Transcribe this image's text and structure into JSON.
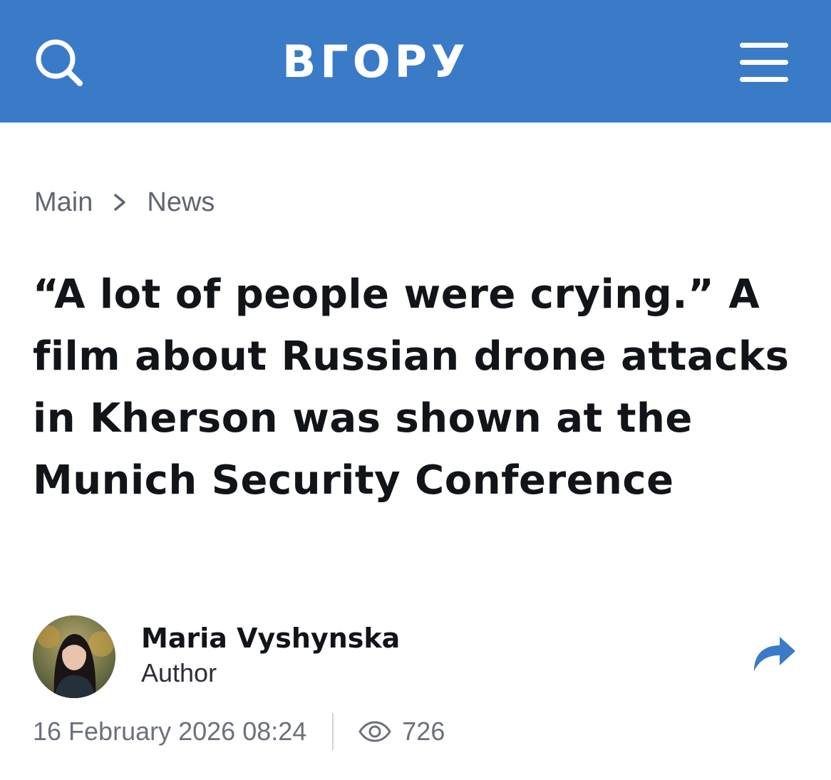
{
  "header": {
    "logo_text": "ВГОРУ",
    "background_color": "#3a7bc8",
    "search_icon": "search-icon",
    "menu_icon": "hamburger-menu-icon"
  },
  "breadcrumb": {
    "items": [
      "Main",
      "News"
    ],
    "separator_icon": "chevron-right-icon"
  },
  "article": {
    "title": "“A lot of people were crying.” A film about Russian drone attacks in Kherson was shown at the Munich Security Conference",
    "author": {
      "name": "Maria Vyshynska",
      "role": "Author",
      "avatar": "author-avatar-photo"
    },
    "share_icon": "share-arrow-icon",
    "date": "16 February 2026 08:24",
    "views": "726",
    "views_icon": "eye-icon"
  }
}
